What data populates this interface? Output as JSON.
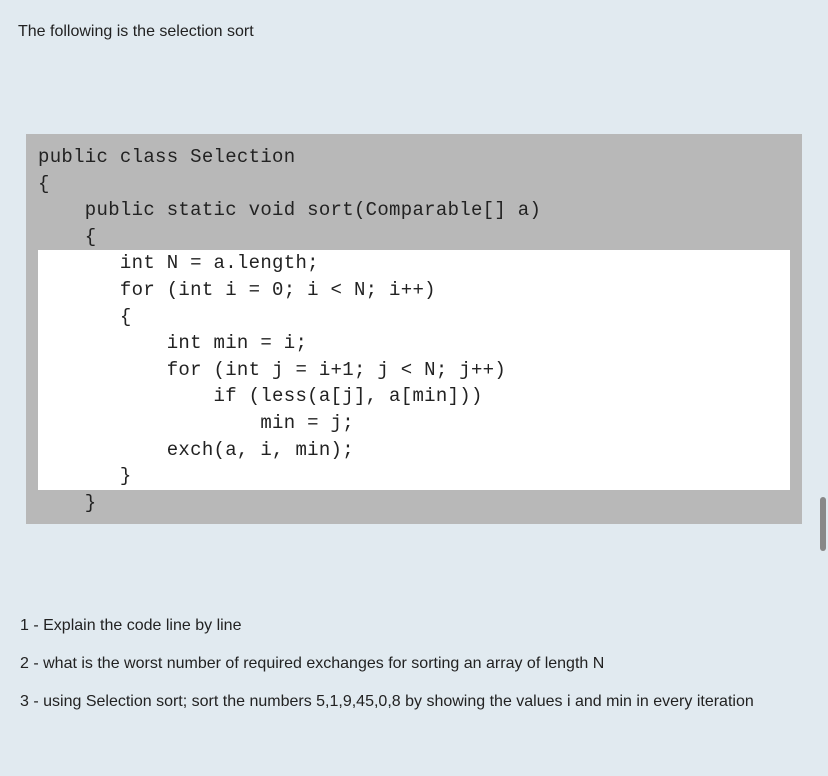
{
  "intro": "The following is the selection sort",
  "code": {
    "lines_top": [
      "public class Selection",
      "{",
      "    public static void sort(Comparable[] a)",
      "    {"
    ],
    "lines_highlight": [
      "       int N = a.length;",
      "       for (int i = 0; i < N; i++)",
      "       {",
      "           int min = i;",
      "           for (int j = i+1; j < N; j++)",
      "               if (less(a[j], a[min]))",
      "                   min = j;",
      "           exch(a, i, min);",
      "       }"
    ],
    "lines_bottom": [
      "    }"
    ]
  },
  "questions": {
    "q1": "1 - Explain the code line by line",
    "q2": "2 - what is the worst number of required exchanges for sorting an array of length N",
    "q3": "3 - using Selection sort; sort the numbers 5,1,9,45,0,8 by showing the values  i and min in every iteration"
  }
}
